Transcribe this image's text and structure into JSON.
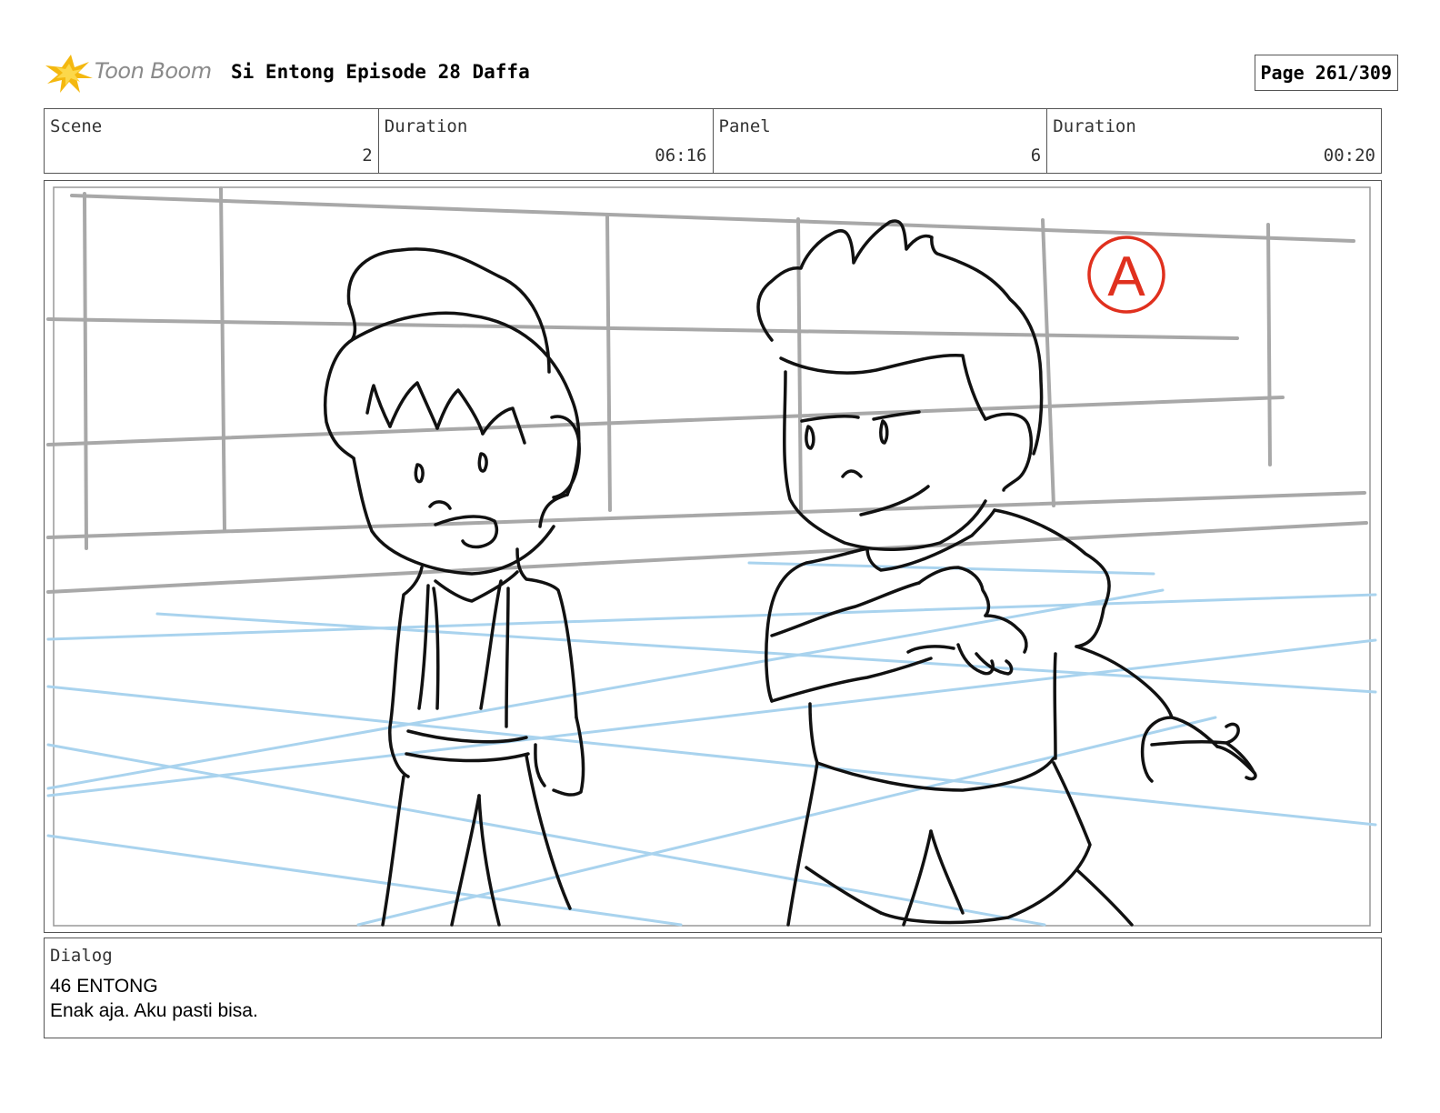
{
  "header": {
    "logo_text": "Toon Boom",
    "title": "Si Entong Episode 28 Daffa",
    "page": "Page 261/309"
  },
  "info": {
    "scene_label": "Scene",
    "scene_value": "2",
    "scene_duration_label": "Duration",
    "scene_duration_value": "06:16",
    "panel_label": "Panel",
    "panel_value": "6",
    "panel_duration_label": "Duration",
    "panel_duration_value": "00:20"
  },
  "panel": {
    "mark_letter": "A",
    "colors": {
      "sketch": "#111111",
      "grid": "#a8a8a8",
      "floor": "#a9d3ee",
      "mark": "#e0301e"
    }
  },
  "dialog": {
    "label": "Dialog",
    "line1": "46 ENTONG",
    "line2": "Enak aja. Aku pasti bisa."
  }
}
